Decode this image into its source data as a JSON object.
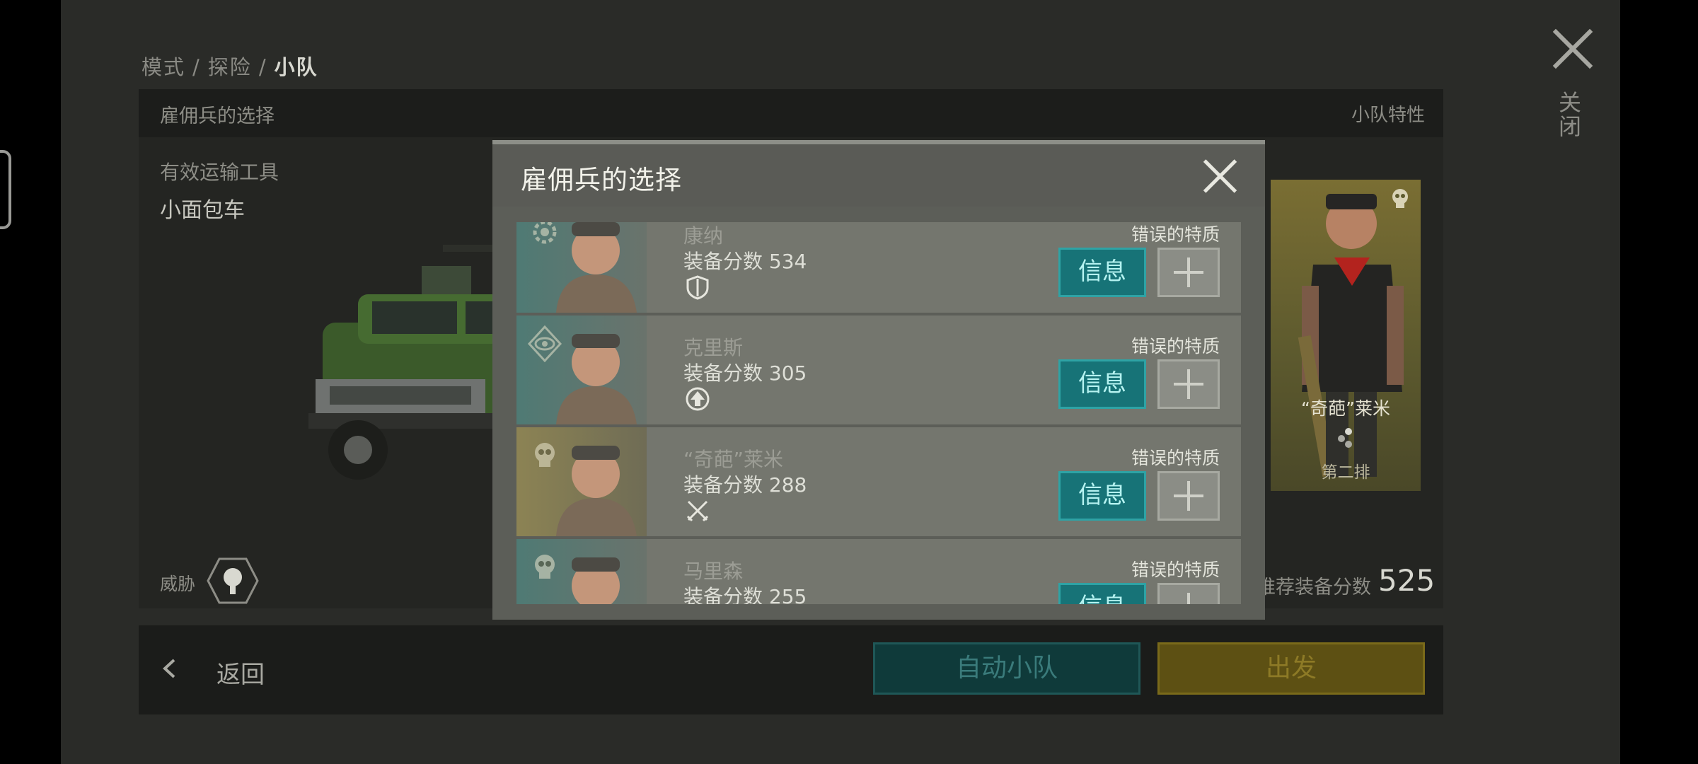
{
  "breadcrumb": {
    "items": [
      "模式",
      "探险"
    ],
    "current": "小队",
    "separator": "/"
  },
  "close": {
    "label": "关闭"
  },
  "squad_panel": {
    "title": "雇佣兵的选择",
    "traits_label": "小队特性",
    "transport_label": "有效运输工具",
    "transport_value": "小面包车",
    "threat_label": "威胁",
    "recommended_label": "推荐装备分数",
    "recommended_value": "525"
  },
  "hero": {
    "name": "“奇葩”莱米",
    "row": "第二排"
  },
  "bottom_bar": {
    "back_label": "返回",
    "auto_label": "自动小队",
    "depart_label": "出发"
  },
  "modal": {
    "title": "雇佣兵的选择",
    "info_label": "信息",
    "mercenaries": [
      {
        "name": "康纳",
        "score": "装备分数 534",
        "trait": "错误的特质",
        "role_icon": "shield-icon",
        "class_icon": "cog-class-icon",
        "color": "#4f7a74"
      },
      {
        "name": "克里斯",
        "score": "装备分数 305",
        "trait": "错误的特质",
        "role_icon": "upgrade-arrow-icon",
        "class_icon": "eye-class-icon",
        "color": "#4f7a74"
      },
      {
        "name": "“奇葩”莱米",
        "score": "装备分数 288",
        "trait": "错误的特质",
        "role_icon": "crossed-swords-icon",
        "class_icon": "skull-class-icon",
        "color": "#8c8354"
      },
      {
        "name": "马里森",
        "score": "装备分数 255",
        "trait": "错误的特质",
        "role_icon": "crossed-swords-icon",
        "class_icon": "skull-class-icon",
        "color": "#4f7a74"
      }
    ]
  },
  "colors": {
    "info_button": "#177377",
    "depart_button": "#5d5013",
    "auto_button": "#0f3a3a",
    "hero_card": "#7a6e33"
  }
}
